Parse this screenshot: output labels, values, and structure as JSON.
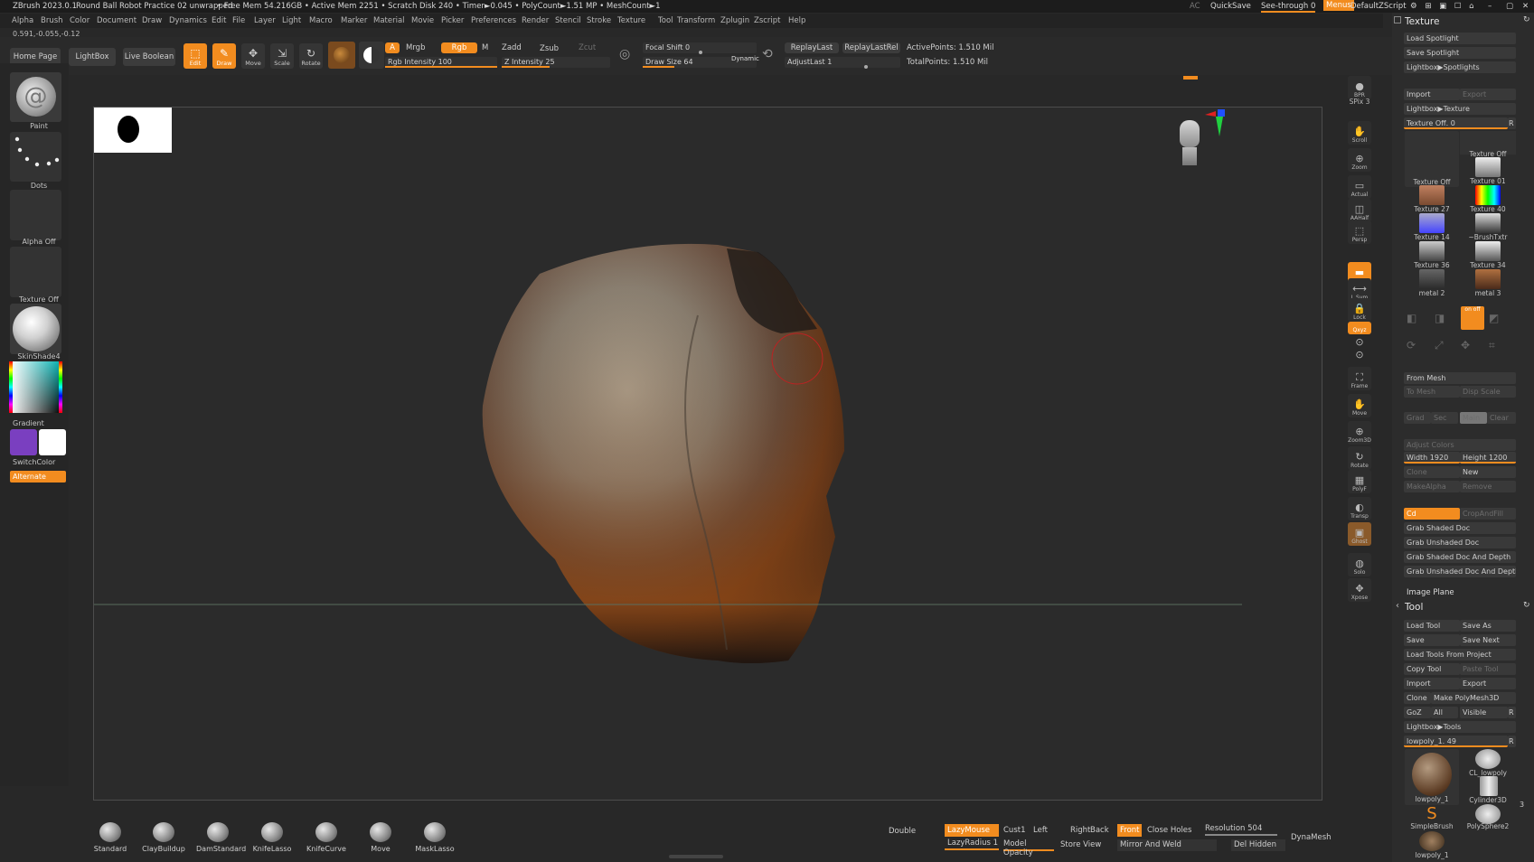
{
  "titlebar": {
    "app": "ZBrush 2023.0.1",
    "document": "Round Ball Robot Practice 02 unwrapped",
    "stats": "• Free Mem 54.216GB • Active Mem 2251 • Scratch Disk 240 • Timer►0.045 • PolyCount►1.51 MP • MeshCount►1",
    "ac": "AC",
    "quicksave": "QuickSave",
    "seethrough": "See-through  0",
    "menus": "Menus",
    "zscript": "DefaultZScript"
  },
  "menubar": [
    "Alpha",
    "Brush",
    "Color",
    "Document",
    "Draw",
    "Dynamics",
    "Edit",
    "File",
    "Layer",
    "Light",
    "Macro",
    "Marker",
    "Material",
    "Movie",
    "Picker",
    "Preferences",
    "Render",
    "Stencil",
    "Stroke",
    "Texture",
    "Tool",
    "Transform",
    "Zplugin",
    "Zscript",
    "Help"
  ],
  "coords": "0.591,-0.055,-0.12",
  "topbar": {
    "home": "Home Page",
    "lightbox": "LightBox",
    "liveboolean": "Live Boolean",
    "edit": "Edit",
    "draw": "Draw",
    "move": "Move",
    "scale": "Scale",
    "rotate": "Rotate",
    "a": "A",
    "mrgb": "Mrgb",
    "rgb": "Rgb",
    "m": "M",
    "zadd": "Zadd",
    "zsub": "Zsub",
    "zcut": "Zcut",
    "rgb_intensity_label": "Rgb Intensity",
    "rgb_intensity": 100,
    "z_intensity_label": "Z Intensity",
    "z_intensity": 25,
    "focal_label": "Focal Shift",
    "focal": 0,
    "drawsize_label": "Draw Size",
    "drawsize": 64,
    "dynamic": "Dynamic",
    "replaylast": "ReplayLast",
    "replaylastrel": "ReplayLastRel",
    "adjustlast_label": "AdjustLast",
    "adjustlast": 1,
    "activepoints": "ActivePoints: 1.510 Mil",
    "totalpoints": "TotalPoints: 1.510 Mil"
  },
  "leftshelf": {
    "paint": "Paint",
    "dots": "Dots",
    "alphaoff": "Alpha Off",
    "textureoff": "Texture Off",
    "skinshade": "SkinShade4",
    "gradient": "Gradient",
    "switchcolor": "SwitchColor",
    "alternate": "Alternate",
    "main_color": "#7a3fc0",
    "secondary_color": "#ffffff"
  },
  "rightshelf": [
    "BPR",
    "SPix 3",
    "Scroll",
    "Zoom",
    "Actual",
    "AAHalf",
    "Persp",
    "Floor",
    "L.Sym",
    "Lock",
    "Qxyz",
    "",
    "",
    "Frame",
    "Move",
    "Zoom3D",
    "Rotate",
    "PolyF",
    "Transp",
    "Ghost",
    "Solo",
    "Xpose"
  ],
  "texture_panel": {
    "title": "Texture",
    "load_spotlight": "Load Spotlight",
    "save_spotlight": "Save Spotlight",
    "lightbox_spotlights": "Lightbox▶Spotlights",
    "import": "Import",
    "export": "Export",
    "lightbox_texture": "Lightbox▶Texture",
    "texture_off_slider": "Texture Off. 0",
    "r": "R",
    "thumbs": [
      "Texture Off",
      "Texture Off",
      "Texture 01",
      "Texture 27",
      "Texture 40",
      "Texture 14",
      "~BrushTxtr",
      "Texture 36",
      "Texture 34",
      "metal 2",
      "metal 3"
    ],
    "on_off": "on off",
    "from_mesh": "From Mesh",
    "to_mesh": "To Mesh",
    "disp_scale": "Disp Scale",
    "grad": "Grad",
    "sec": "Sec",
    "main": "Main",
    "clear": "Clear",
    "adjust_colors": "Adjust Colors",
    "width_label": "Width",
    "width": 1920,
    "height_label": "Height",
    "height": 1200,
    "clone": "Clone",
    "new": "New",
    "makealpha": "MakeAlpha",
    "remove": "Remove",
    "cd": "Cd",
    "cropandfill": "CropAndFill",
    "grab_shaded": "Grab Shaded Doc",
    "grab_unshaded": "Grab Unshaded Doc",
    "grab_shaded_depth": "Grab Shaded Doc And Depth",
    "grab_unshaded_depth": "Grab Unshaded Doc And Depth",
    "image_plane": "Image Plane"
  },
  "tool_panel": {
    "title": "Tool",
    "load_tool": "Load Tool",
    "save_as": "Save As",
    "save": "Save",
    "save_next": "Save Next",
    "load_from_project": "Load Tools From Project",
    "copy_tool": "Copy Tool",
    "paste_tool": "Paste Tool",
    "import": "Import",
    "export": "Export",
    "clone": "Clone",
    "make_polymesh": "Make PolyMesh3D",
    "goz": "GoZ",
    "all": "All",
    "visible": "Visible",
    "r": "R",
    "lightbox_tools": "Lightbox▶Tools",
    "current_tool": "lowpoly_1. 49",
    "tools": [
      "lowpoly_1",
      "CL_lowpoly",
      "Cylinder3D",
      "SimpleBrush",
      "PolySphere2",
      "lowpoly_1"
    ],
    "count": "3"
  },
  "bottombar": {
    "brushes": [
      "Standard",
      "ClayBuildup",
      "DamStandard",
      "KnifeLasso",
      "KnifeCurve",
      "Move",
      "MaskLasso"
    ],
    "double": "Double",
    "lazymouse": "LazyMouse",
    "lazyradius_label": "LazyRadius",
    "lazyradius": 1,
    "cust1": "Cust1",
    "left": "Left",
    "right": "Right",
    "back": "Back",
    "front": "Front",
    "close_holes": "Close Holes",
    "resolution_label": "Resolution",
    "resolution": 504,
    "model_opacity": "Model Opacity",
    "store_view": "Store View",
    "mirror_weld": "Mirror And Weld",
    "del_hidden": "Del Hidden",
    "dynamesh": "DynaMesh"
  }
}
